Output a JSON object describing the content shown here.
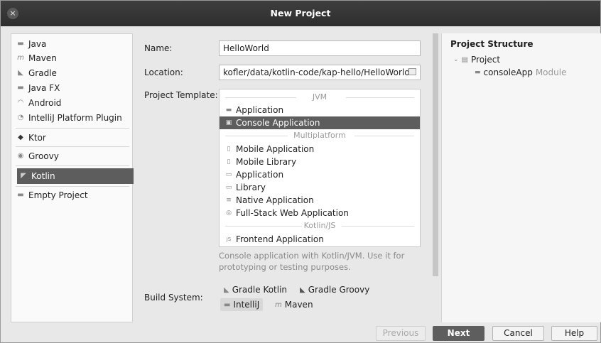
{
  "window": {
    "title": "New Project",
    "close_glyph": "×"
  },
  "generators": {
    "group1": [
      {
        "label": "Java",
        "icon": "java-icon"
      },
      {
        "label": "Maven",
        "icon": "maven-icon"
      },
      {
        "label": "Gradle",
        "icon": "gradle-icon"
      },
      {
        "label": "Java FX",
        "icon": "javafx-icon"
      },
      {
        "label": "Android",
        "icon": "android-icon"
      },
      {
        "label": "IntelliJ Platform Plugin",
        "icon": "intellij-plugin-icon"
      }
    ],
    "ktor": {
      "label": "Ktor",
      "icon": "ktor-icon"
    },
    "groovy": {
      "label": "Groovy",
      "icon": "groovy-icon"
    },
    "kotlin": {
      "label": "Kotlin",
      "icon": "kotlin-icon"
    },
    "empty": {
      "label": "Empty Project",
      "icon": "empty-project-icon"
    }
  },
  "form": {
    "name_label": "Name:",
    "name_value": "HelloWorld",
    "location_label": "Location:",
    "location_value": "kofler/data/kotlin-code/kap-hello/HelloWorld",
    "template_label": "Project Template:",
    "build_system_label": "Build System:"
  },
  "templates": {
    "jvm_header": "JVM",
    "multiplatform_header": "Multiplatform",
    "kotlinjs_header": "Kotlin/JS",
    "jvm": [
      {
        "label": "Application",
        "icon": "jvm-application-icon"
      },
      {
        "label": "Console Application",
        "icon": "console-application-icon"
      }
    ],
    "multiplatform": [
      {
        "label": "Mobile Application",
        "icon": "mobile-application-icon"
      },
      {
        "label": "Mobile Library",
        "icon": "mobile-library-icon"
      },
      {
        "label": "Application",
        "icon": "multiplatform-application-icon"
      },
      {
        "label": "Library",
        "icon": "multiplatform-library-icon"
      },
      {
        "label": "Native Application",
        "icon": "native-application-icon"
      },
      {
        "label": "Full-Stack Web Application",
        "icon": "web-application-icon"
      }
    ],
    "kotlinjs": [
      {
        "label": "Frontend Application",
        "icon": "js-icon"
      }
    ],
    "description": "Console application with Kotlin/JVM. Use it for prototyping or testing purposes."
  },
  "build_system": {
    "gradle_kotlin": "Gradle Kotlin",
    "gradle_groovy": "Gradle Groovy",
    "intellij": "IntelliJ",
    "maven": "Maven"
  },
  "structure": {
    "title": "Project Structure",
    "project": "Project",
    "module_name": "consoleApp",
    "module_suffix": "Module"
  },
  "footer": {
    "previous": "Previous",
    "next": "Next",
    "cancel": "Cancel",
    "help": "Help"
  }
}
